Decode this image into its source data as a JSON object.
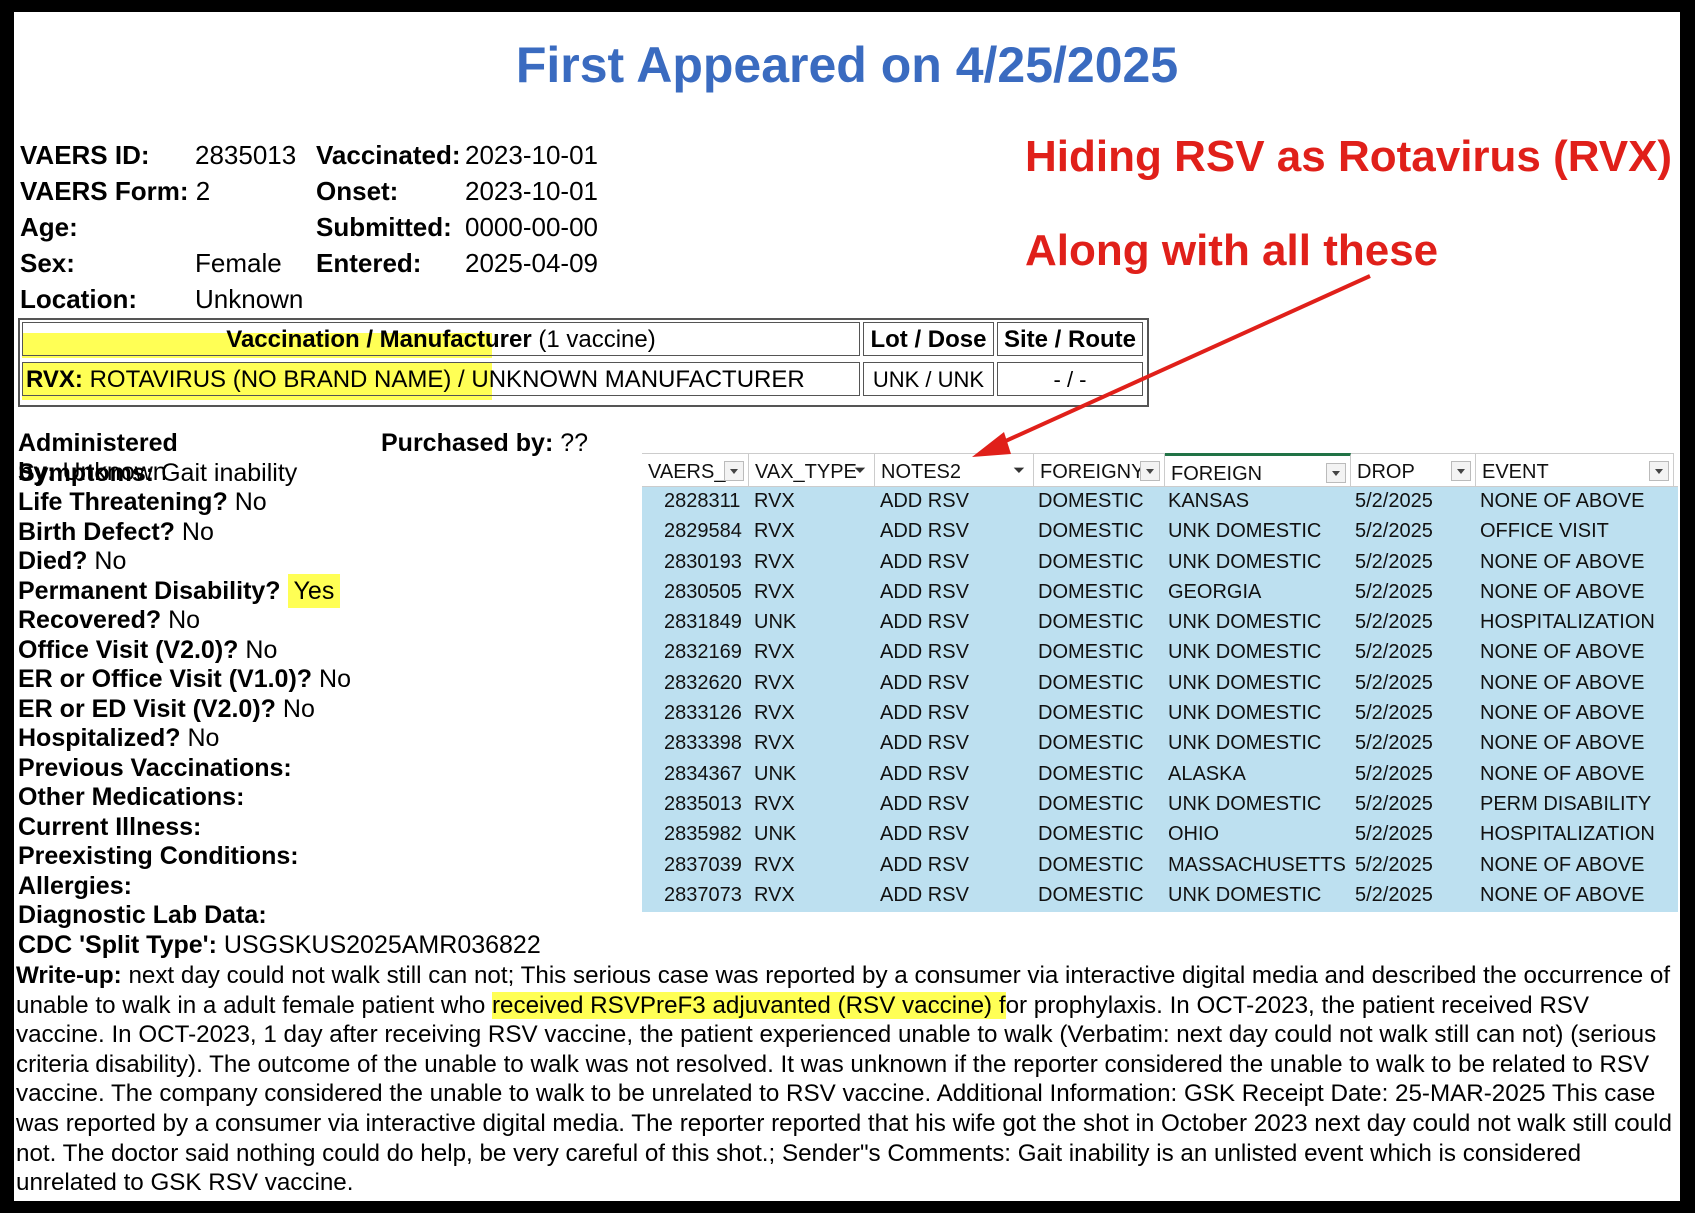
{
  "title": "First Appeared on 4/25/2025",
  "annotations": {
    "line1": "Hiding RSV as Rotavirus (RVX)",
    "line2": "Along with all these"
  },
  "report": {
    "left": [
      {
        "label": "VAERS ID:",
        "value": "2835013"
      },
      {
        "label": "VAERS Form:",
        "value": "2"
      },
      {
        "label": "Age:",
        "value": ""
      },
      {
        "label": "Sex:",
        "value": "Female"
      },
      {
        "label": "Location:",
        "value": "Unknown"
      }
    ],
    "right": [
      {
        "label": "Vaccinated:",
        "value": "2023-10-01"
      },
      {
        "label": "Onset:",
        "value": "2023-10-01"
      },
      {
        "label": "Submitted:",
        "value": "0000-00-00"
      },
      {
        "label": "Entered:",
        "value": "2025-04-09"
      }
    ]
  },
  "vaccine_table": {
    "header_bold": "Vaccination / Manufacturer",
    "header_rest": "(1 vaccine)",
    "lot_header": "Lot / Dose",
    "site_header": "Site / Route",
    "code": "RVX:",
    "name": "ROTAVIRUS (NO BRAND NAME) /",
    "manufacturer": "UNKNOWN MANUFACTURER",
    "lot": "UNK / UNK",
    "site": "- / -"
  },
  "details": [
    {
      "label": "Administered by:",
      "value": "Unknown"
    },
    {
      "label": "Symptoms:",
      "value": "Gait inability"
    },
    {
      "label": "Life Threatening?",
      "value": "No"
    },
    {
      "label": "Birth Defect?",
      "value": "No"
    },
    {
      "label": "Died?",
      "value": "No"
    },
    {
      "label": "Permanent Disability?",
      "value": "Yes"
    },
    {
      "label": "Recovered?",
      "value": "No"
    },
    {
      "label": "Office Visit (V2.0)?",
      "value": "No"
    },
    {
      "label": "ER or Office Visit (V1.0)?",
      "value": "No"
    },
    {
      "label": "ER or ED Visit (V2.0)?",
      "value": "No"
    },
    {
      "label": "Hospitalized?",
      "value": "No"
    },
    {
      "label": "Previous Vaccinations:",
      "value": ""
    },
    {
      "label": "Other Medications:",
      "value": ""
    },
    {
      "label": "Current Illness:",
      "value": ""
    },
    {
      "label": "Preexisting Conditions:",
      "value": ""
    },
    {
      "label": "Allergies:",
      "value": ""
    },
    {
      "label": "Diagnostic Lab Data:",
      "value": ""
    },
    {
      "label": "CDC 'Split Type':",
      "value": "USGSKUS2025AMR036822"
    }
  ],
  "purchased": {
    "label": "Purchased by:",
    "value": "??"
  },
  "sheet": {
    "columns": [
      "VAERS_",
      "VAX_TYPE",
      "NOTES2",
      "FOREIGNY",
      "FOREIGN",
      "DROP",
      "EVENT"
    ],
    "rows": [
      [
        "2828311",
        "RVX",
        "ADD RSV",
        "DOMESTIC",
        "KANSAS",
        "5/2/2025",
        "NONE OF ABOVE"
      ],
      [
        "2829584",
        "RVX",
        "ADD RSV",
        "DOMESTIC",
        "UNK DOMESTIC",
        "5/2/2025",
        "OFFICE VISIT"
      ],
      [
        "2830193",
        "RVX",
        "ADD RSV",
        "DOMESTIC",
        "UNK DOMESTIC",
        "5/2/2025",
        "NONE OF ABOVE"
      ],
      [
        "2830505",
        "RVX",
        "ADD RSV",
        "DOMESTIC",
        "GEORGIA",
        "5/2/2025",
        "NONE OF ABOVE"
      ],
      [
        "2831849",
        "UNK",
        "ADD RSV",
        "DOMESTIC",
        "UNK DOMESTIC",
        "5/2/2025",
        "HOSPITALIZATION"
      ],
      [
        "2832169",
        "RVX",
        "ADD RSV",
        "DOMESTIC",
        "UNK DOMESTIC",
        "5/2/2025",
        "NONE OF ABOVE"
      ],
      [
        "2832620",
        "RVX",
        "ADD RSV",
        "DOMESTIC",
        "UNK DOMESTIC",
        "5/2/2025",
        "NONE OF ABOVE"
      ],
      [
        "2833126",
        "RVX",
        "ADD RSV",
        "DOMESTIC",
        "UNK DOMESTIC",
        "5/2/2025",
        "NONE OF ABOVE"
      ],
      [
        "2833398",
        "RVX",
        "ADD RSV",
        "DOMESTIC",
        "UNK DOMESTIC",
        "5/2/2025",
        "NONE OF ABOVE"
      ],
      [
        "2834367",
        "UNK",
        "ADD RSV",
        "DOMESTIC",
        "ALASKA",
        "5/2/2025",
        "NONE OF ABOVE"
      ],
      [
        "2835013",
        "RVX",
        "ADD RSV",
        "DOMESTIC",
        "UNK DOMESTIC",
        "5/2/2025",
        "PERM DISABILITY"
      ],
      [
        "2835982",
        "UNK",
        "ADD RSV",
        "DOMESTIC",
        "OHIO",
        "5/2/2025",
        "HOSPITALIZATION"
      ],
      [
        "2837039",
        "RVX",
        "ADD RSV",
        "DOMESTIC",
        "MASSACHUSETTS",
        "5/2/2025",
        "NONE OF ABOVE"
      ],
      [
        "2837073",
        "RVX",
        "ADD RSV",
        "DOMESTIC",
        "UNK DOMESTIC",
        "5/2/2025",
        "NONE OF ABOVE"
      ]
    ]
  },
  "writeup": {
    "label": "Write-up:",
    "part1": "next day could not walk still can not; This serious case was reported by a consumer via interactive digital media and described the occurrence of unable to walk in a adult female patient who ",
    "highlight": "received RSVPreF3 adjuvanted (RSV vaccine) f",
    "part2": "or prophylaxis. In OCT-2023, the patient received RSV vaccine. In OCT-2023, 1 day after receiving RSV vaccine, the patient experienced unable to walk (Verbatim: next day could not walk still can not) (serious criteria disability). The outcome of the unable to walk was not resolved. It was unknown if the reporter considered the unable to walk to be related to RSV vaccine. The company considered the unable to walk to be unrelated to RSV vaccine. Additional Information: GSK Receipt Date: 25-MAR-2025 This case was reported by a consumer via interactive digital media. The reporter reported that his wife got the shot in October 2023 next day could not walk still could not. The doctor said nothing could do help, be very careful of this shot.; Sender\"s Comments: Gait inability is an unlisted event which is considered unrelated to GSK RSV vaccine."
  }
}
